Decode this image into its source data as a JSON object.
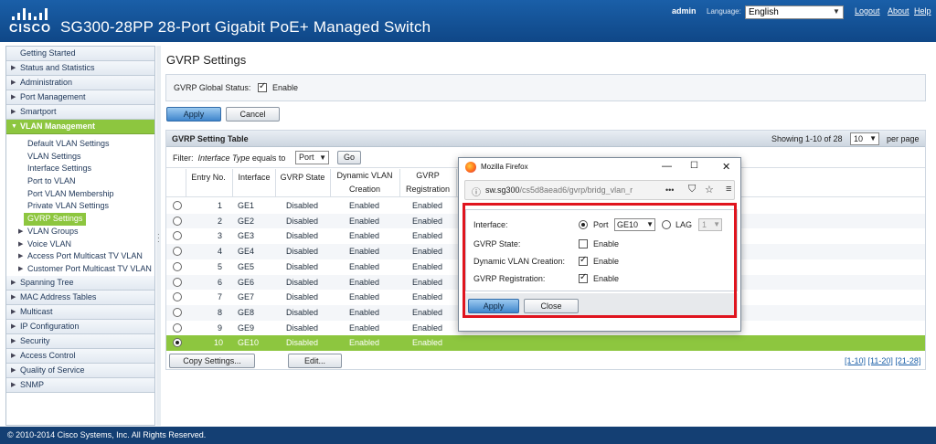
{
  "header": {
    "logo_text": "CISCO",
    "product_title": "SG300-28PP 28-Port Gigabit PoE+ Managed Switch",
    "user": "admin",
    "language_label": "Language:",
    "language_value": "English",
    "links": {
      "logout": "Logout",
      "about": "About",
      "help": "Help"
    }
  },
  "sidebar": {
    "getting_started": "Getting Started",
    "status": "Status and Statistics",
    "administration": "Administration",
    "port_mgmt": "Port Management",
    "smartport": "Smartport",
    "vlan_mgmt": "VLAN Management",
    "vlan_sub": [
      "Default VLAN Settings",
      "VLAN Settings",
      "Interface Settings",
      "Port to VLAN",
      "Port VLAN Membership",
      "Private VLAN Settings",
      "GVRP Settings"
    ],
    "vlan_groups": "VLAN Groups",
    "voice_vlan": "Voice VLAN",
    "access_mtv": "Access Port Multicast TV VLAN",
    "customer_mtv": "Customer Port Multicast TV VLAN",
    "spanning_tree": "Spanning Tree",
    "mac_tables": "MAC Address Tables",
    "multicast": "Multicast",
    "ip_config": "IP Configuration",
    "security": "Security",
    "access_control": "Access Control",
    "qos": "Quality of Service",
    "snmp": "SNMP"
  },
  "main": {
    "title": "GVRP Settings",
    "global_status_label": "GVRP Global Status:",
    "global_status_value": "Enable",
    "apply": "Apply",
    "cancel": "Cancel",
    "table_title": "GVRP Setting Table",
    "showing": "Showing 1-10 of 28",
    "per_page_value": "10",
    "per_page_label": "per page",
    "filter_label": "Filter:",
    "filter_italic": "Interface Type",
    "filter_equals": "equals to",
    "filter_value": "Port",
    "go": "Go",
    "columns": {
      "entry": "Entry No.",
      "interface": "Interface",
      "state": "GVRP State",
      "dyn1": "Dynamic VLAN",
      "dyn2": "Creation",
      "reg1": "GVRP",
      "reg2": "Registration"
    },
    "rows": [
      {
        "no": "1",
        "iface": "GE1",
        "state": "Disabled",
        "dyn": "Enabled",
        "reg": "Enabled"
      },
      {
        "no": "2",
        "iface": "GE2",
        "state": "Disabled",
        "dyn": "Enabled",
        "reg": "Enabled"
      },
      {
        "no": "3",
        "iface": "GE3",
        "state": "Disabled",
        "dyn": "Enabled",
        "reg": "Enabled"
      },
      {
        "no": "4",
        "iface": "GE4",
        "state": "Disabled",
        "dyn": "Enabled",
        "reg": "Enabled"
      },
      {
        "no": "5",
        "iface": "GE5",
        "state": "Disabled",
        "dyn": "Enabled",
        "reg": "Enabled"
      },
      {
        "no": "6",
        "iface": "GE6",
        "state": "Disabled",
        "dyn": "Enabled",
        "reg": "Enabled"
      },
      {
        "no": "7",
        "iface": "GE7",
        "state": "Disabled",
        "dyn": "Enabled",
        "reg": "Enabled"
      },
      {
        "no": "8",
        "iface": "GE8",
        "state": "Disabled",
        "dyn": "Enabled",
        "reg": "Enabled"
      },
      {
        "no": "9",
        "iface": "GE9",
        "state": "Disabled",
        "dyn": "Enabled",
        "reg": "Enabled"
      },
      {
        "no": "10",
        "iface": "GE10",
        "state": "Disabled",
        "dyn": "Enabled",
        "reg": "Enabled"
      }
    ],
    "copy_settings": "Copy Settings...",
    "edit": "Edit...",
    "pager": [
      "[1-10]",
      "[11-20]",
      "[21-28]"
    ]
  },
  "popup": {
    "window_title": "Mozilla Firefox",
    "url_host": "sw.sg300",
    "url_path": "/cs5d8aead6/gvrp/bridg_vlan_r",
    "interface_label": "Interface:",
    "port_label": "Port",
    "port_value": "GE10",
    "lag_label": "LAG",
    "lag_value": "1",
    "state_label": "GVRP State:",
    "dyn_label": "Dynamic VLAN Creation:",
    "reg_label": "GVRP Registration:",
    "enable": "Enable",
    "apply": "Apply",
    "close": "Close"
  },
  "footer": "© 2010-2014 Cisco Systems, Inc. All Rights Reserved.",
  "colors": {
    "header": "#1a5fa8",
    "accent_green": "#8dc63f",
    "highlight_red": "#e0141e",
    "footer": "#143f73"
  }
}
